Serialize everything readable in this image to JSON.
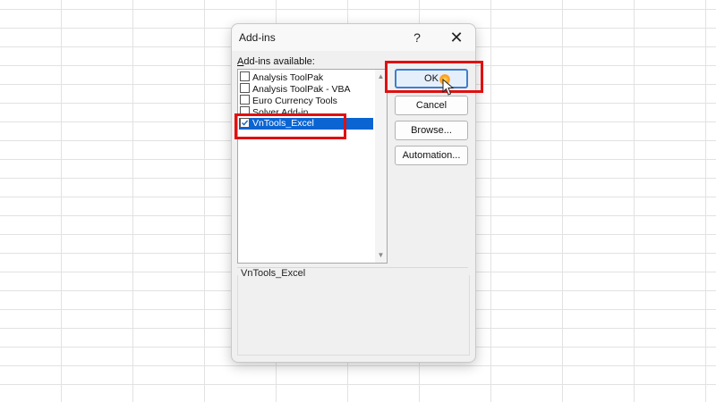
{
  "dialog": {
    "title": "Add-ins",
    "help_label": "?",
    "close_label": "✕",
    "list_label_accel": "A",
    "list_label_rest": "dd-ins available:",
    "items": [
      {
        "label": "Analysis ToolPak",
        "checked": false,
        "selected": false
      },
      {
        "label": "Analysis ToolPak - VBA",
        "checked": false,
        "selected": false
      },
      {
        "label": "Euro Currency Tools",
        "checked": false,
        "selected": false
      },
      {
        "label": "Solver Add-in",
        "checked": false,
        "selected": false
      },
      {
        "label": "VnTools_Excel",
        "checked": true,
        "selected": true
      }
    ],
    "buttons": {
      "ok": "OK",
      "cancel": "Cancel",
      "browse": "Browse...",
      "automation": "Automation..."
    },
    "description_title": "VnTools_Excel"
  },
  "icons": {
    "scroll_up": "scroll-up-arrow-icon",
    "scroll_down": "scroll-down-arrow-icon",
    "cursor": "mouse-pointer-icon"
  },
  "colors": {
    "selection": "#0a64d2",
    "highlight": "#e01010"
  }
}
